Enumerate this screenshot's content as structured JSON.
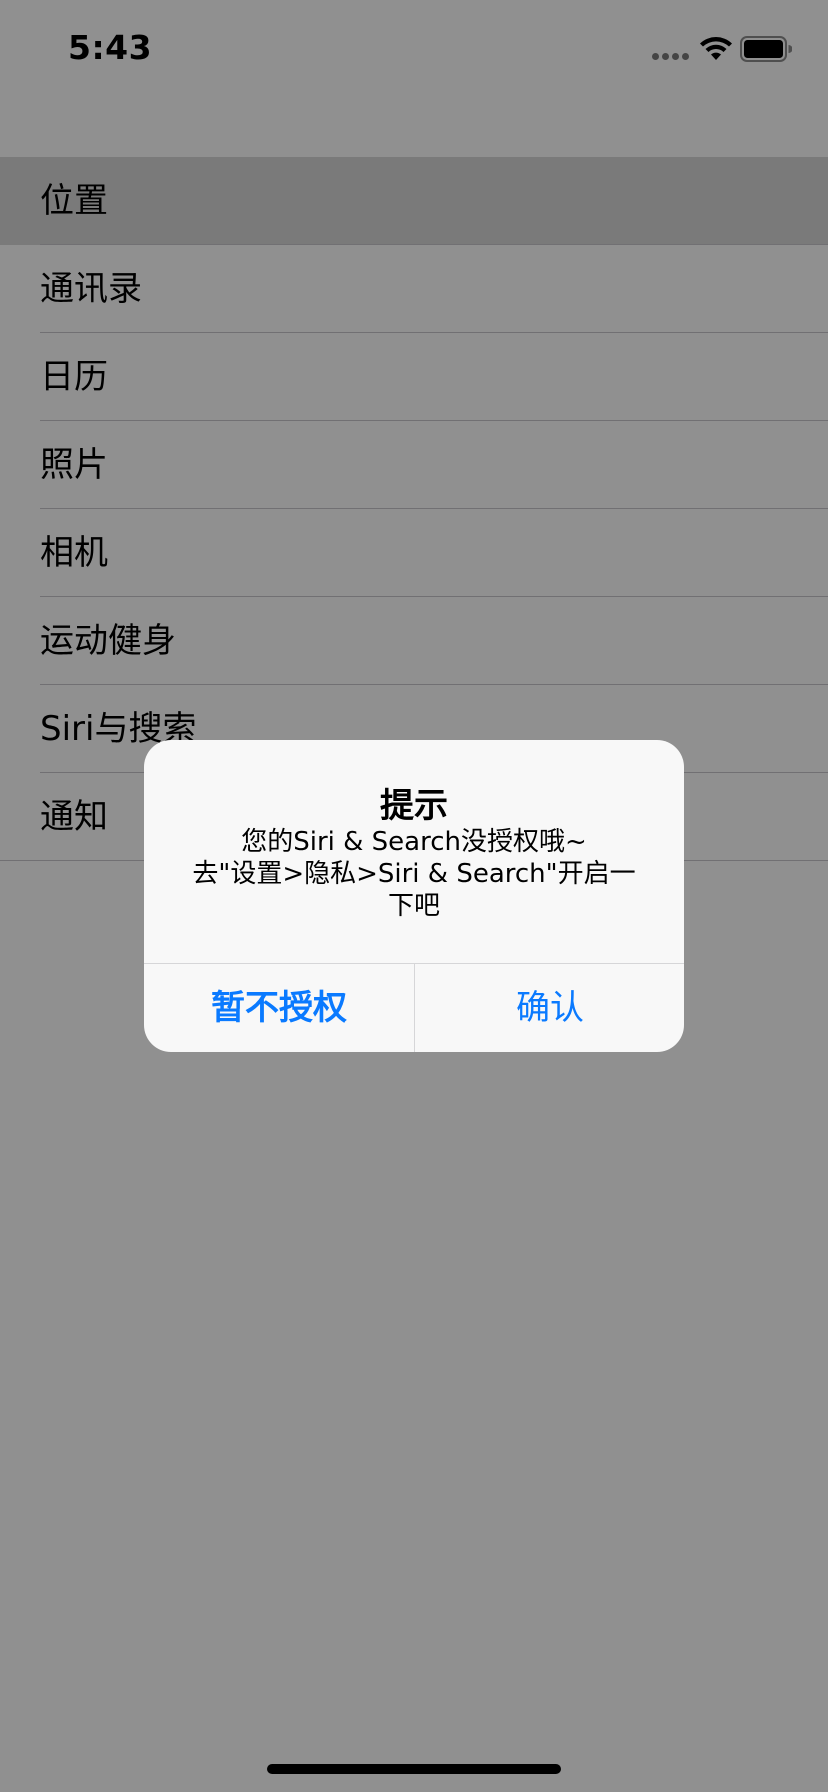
{
  "status_bar": {
    "time": "5:43",
    "icons": [
      "signal-dots-icon",
      "wifi-icon",
      "battery-icon"
    ]
  },
  "list": {
    "items": [
      {
        "label": "位置",
        "selected": true
      },
      {
        "label": "通讯录",
        "selected": false
      },
      {
        "label": "日历",
        "selected": false
      },
      {
        "label": "照片",
        "selected": false
      },
      {
        "label": "相机",
        "selected": false
      },
      {
        "label": "运动健身",
        "selected": false
      },
      {
        "label": "Siri与搜索",
        "selected": false
      },
      {
        "label": "通知",
        "selected": false
      }
    ]
  },
  "alert": {
    "title": "提示",
    "message": "您的Siri & Search没授权哦~\n去\"设置>隐私>Siri & Search\"开启一下吧",
    "cancel_label": "暂不授权",
    "confirm_label": "确认",
    "button_color": "#0a7aff"
  },
  "colors": {
    "background": "#ffffff",
    "selected_row": "#d9d9d9",
    "overlay": "rgba(0,0,0,0.435)",
    "separator": "#c8c7cc"
  }
}
